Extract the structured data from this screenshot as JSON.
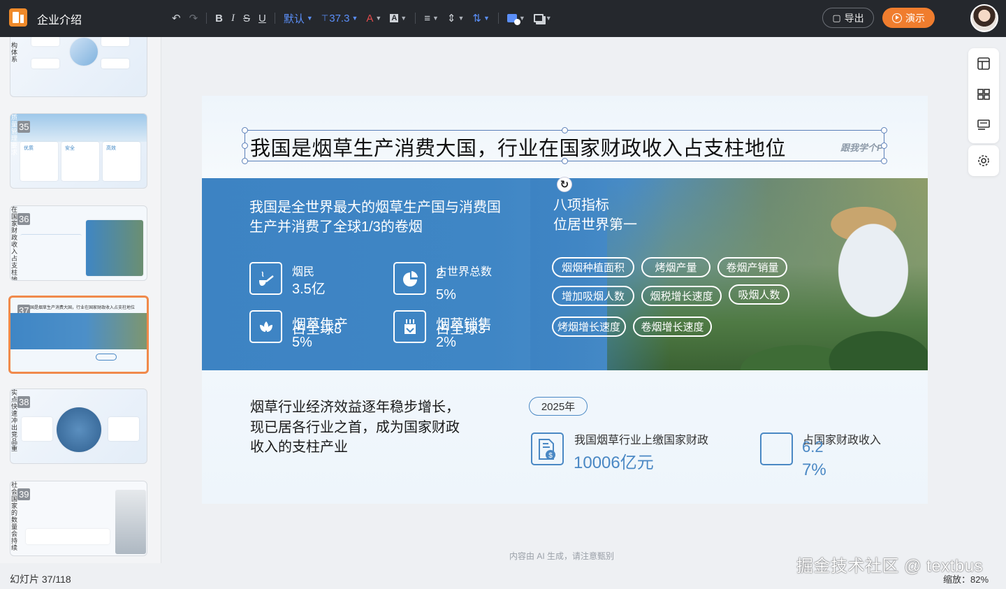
{
  "app": {
    "doc_title": "企业介绍"
  },
  "toolbar": {
    "font_family": "默认",
    "font_size": "37.3",
    "export_label": "导出",
    "present_label": "演示"
  },
  "thumbnails": [
    {
      "number": "",
      "side_text": "构体系"
    },
    {
      "number": "35",
      "side_text": "质量管理要求",
      "cards": [
        "优质",
        "安全",
        "高效"
      ]
    },
    {
      "number": "36",
      "side_text": "在国家财政收入占支柱地位"
    },
    {
      "number": "37",
      "title": "我国是烟草生产消费大国，行业在国家财政收入占支柱地位"
    },
    {
      "number": "38",
      "side_text": "实点，快速冲出竞品重"
    },
    {
      "number": "39",
      "side_text": "社会国家的数量会持续"
    }
  ],
  "slide": {
    "title": "我国是烟草生产消费大国，行业在国家财政收入占支柱地位",
    "brand": "跟我学个P",
    "lead": "我国是全世界最大的烟草生产国与消费国生产并消费了全球1/3的卷烟",
    "stats": [
      {
        "label": "烟民",
        "value": "3.5亿"
      },
      {
        "label": "占世界总数",
        "value_a": "2",
        "value_b": "5%"
      },
      {
        "label": "烟草生产",
        "label_overlap": "占全球3",
        "value": "5%"
      },
      {
        "label": "烟草销售",
        "label_overlap": "占全球3",
        "value": "2%"
      }
    ],
    "index_heading_1": "八项指标",
    "index_heading_2": "位居世界第一",
    "indicators": [
      "烟烟种植面积",
      "烤烟产量",
      "卷烟产销量",
      "增加吸烟人数",
      "烟税增长速度",
      "吸烟人数",
      "烤烟增长速度",
      "卷烟增长速度"
    ],
    "lower_text": "烟草行业经济效益逐年稳步增长，现已居各行业之首，成为国家财政收入的支柱产业",
    "year": "2025年",
    "fiscal_label": "我国烟草行业上缴国家财政",
    "fiscal_value": "10006亿元",
    "share_label": "占国家财政收入",
    "share_value_a": "6.2",
    "share_value_b": "7%"
  },
  "status": {
    "slide_counter": "幻灯片 37/118",
    "ai_note": "内容由 AI 生成，请注意甄别",
    "zoom": "缩放：82%"
  },
  "watermark": "掘金技术社区 @ textbus",
  "colors": {
    "accent": "#f07d2e",
    "band_blue": "#3f86c5",
    "value_blue": "#4a88c4",
    "topbar": "#25282d"
  }
}
